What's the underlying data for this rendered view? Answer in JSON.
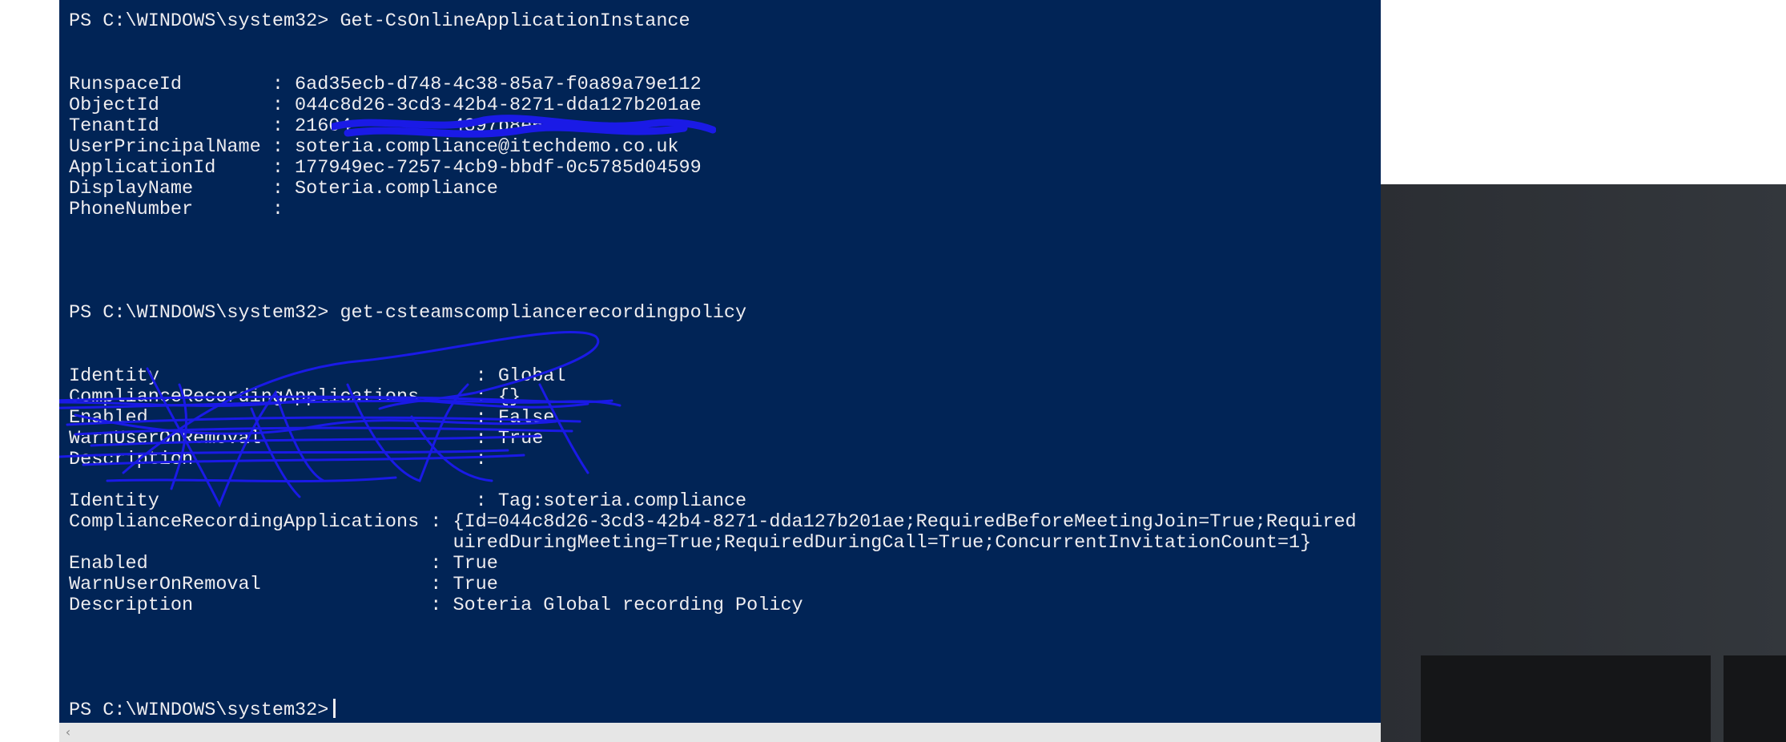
{
  "terminal": {
    "lines": [
      "PS C:\\WINDOWS\\system32> Get-CsOnlineApplicationInstance",
      "RunspaceId        : 6ad35ecb-d748-4c38-85a7-f0a89a79e112",
      "ObjectId          : 044c8d26-3cd3-42b4-8271-dda127b201ae",
      "TenantId          : 21604         4897b8e63",
      "UserPrincipalName : soteria.compliance@itechdemo.co.uk",
      "ApplicationId     : 177949ec-7257-4cb9-bbdf-0c5785d04599",
      "DisplayName       : Soteria.compliance",
      "PhoneNumber       :",
      "PS C:\\WINDOWS\\system32> get-csteamscompliancerecordingpolicy",
      "Identity                            : Global",
      "ComplianceRecordingApplications     : {}",
      "Enabled                             : False",
      "WarnUserOnRemoval                   : True",
      "Description                         :",
      "Identity                            : Tag:soteria.compliance",
      "ComplianceRecordingApplications : {Id=044c8d26-3cd3-42b4-8271-dda127b201ae;RequiredBeforeMeetingJoin=True;Required",
      "                                  uiredDuringMeeting=True;RequiredDuringCall=True;ConcurrentInvitationCount=1}",
      "Enabled                         : True",
      "WarnUserOnRemoval               : True",
      "Description                     : Soteria Global recording Policy",
      "PS C:\\WINDOWS\\system32>"
    ]
  },
  "colors": {
    "terminal_bg": "#012456",
    "terminal_text": "#eeedf0",
    "redaction_scribble": "#1a1ae6"
  },
  "scrollbar": {
    "left_arrow_icon": "chevron-left-icon",
    "left_arrow_glyph": "‹"
  }
}
